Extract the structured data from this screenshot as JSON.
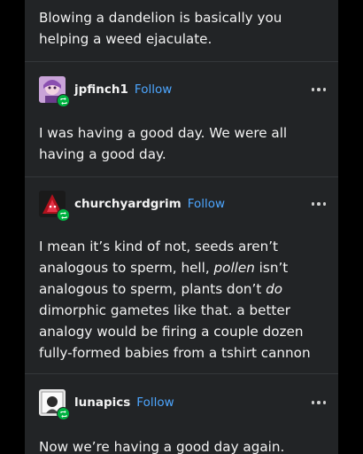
{
  "posts": [
    {
      "text": "Blowing a dandelion is basically you helping a weed ejaculate."
    },
    {
      "username": "jpfinch1",
      "follow_label": "Follow",
      "avatar_icon": "jpfinch1-avatar-icon",
      "text": "I was having a good day. We were all having a good day."
    },
    {
      "username": "churchyardgrim",
      "follow_label": "Follow",
      "avatar_icon": "churchyardgrim-avatar-icon",
      "text_parts": [
        "I mean it’s kind of not, seeds aren’t analogous to sperm, hell, ",
        "pollen",
        " isn’t analogous to sperm, plants don’t ",
        "do",
        " dimorphic gametes like that. a better analogy would be firing a couple dozen fully-formed babies from a tshirt cannon"
      ]
    },
    {
      "username": "lunapics",
      "follow_label": "Follow",
      "avatar_icon": "lunapics-avatar-icon",
      "text": "Now we’re having a good day again."
    }
  ],
  "colors": {
    "background": "#222426",
    "follow": "#4da6ff",
    "reblog_badge": "#00b341"
  }
}
